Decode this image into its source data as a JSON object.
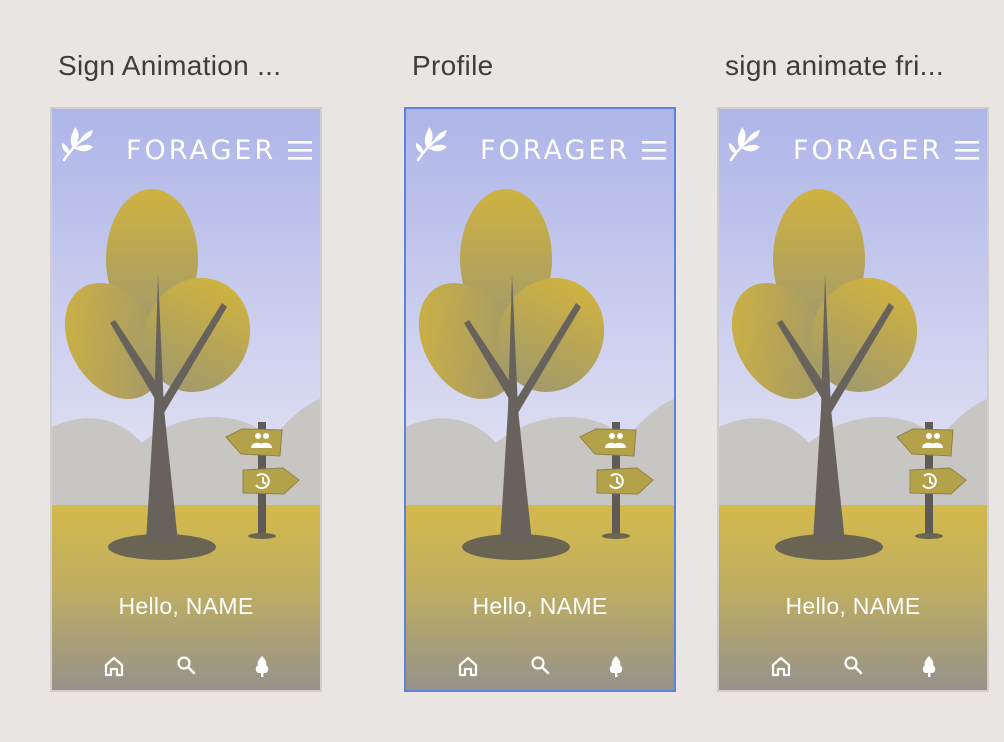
{
  "artboards": [
    {
      "title": "Sign Animation ...",
      "selected": false
    },
    {
      "title": "Profile",
      "selected": true
    },
    {
      "title": "sign animate fri...",
      "selected": false
    }
  ],
  "app": {
    "brand": "FORAGER",
    "greeting": "Hello, NAME",
    "header_icons": [
      "leaf-logo-icon",
      "hamburger-menu-icon"
    ],
    "nav_icons": [
      "home-icon",
      "search-icon",
      "tree-icon"
    ],
    "sign_icons": [
      "friends-icon",
      "history-icon"
    ]
  },
  "colors": {
    "canvas": "#e8e5e3",
    "sky_top": "#aeb5e8",
    "sky_bottom": "#e3e3f4",
    "hills": "#c8c6c2",
    "ground": "#d4b94b",
    "ground_bottom": "#9b9689",
    "foliage": "#cdb243",
    "trunk": "#67625c",
    "selection": "#5d82d9"
  }
}
